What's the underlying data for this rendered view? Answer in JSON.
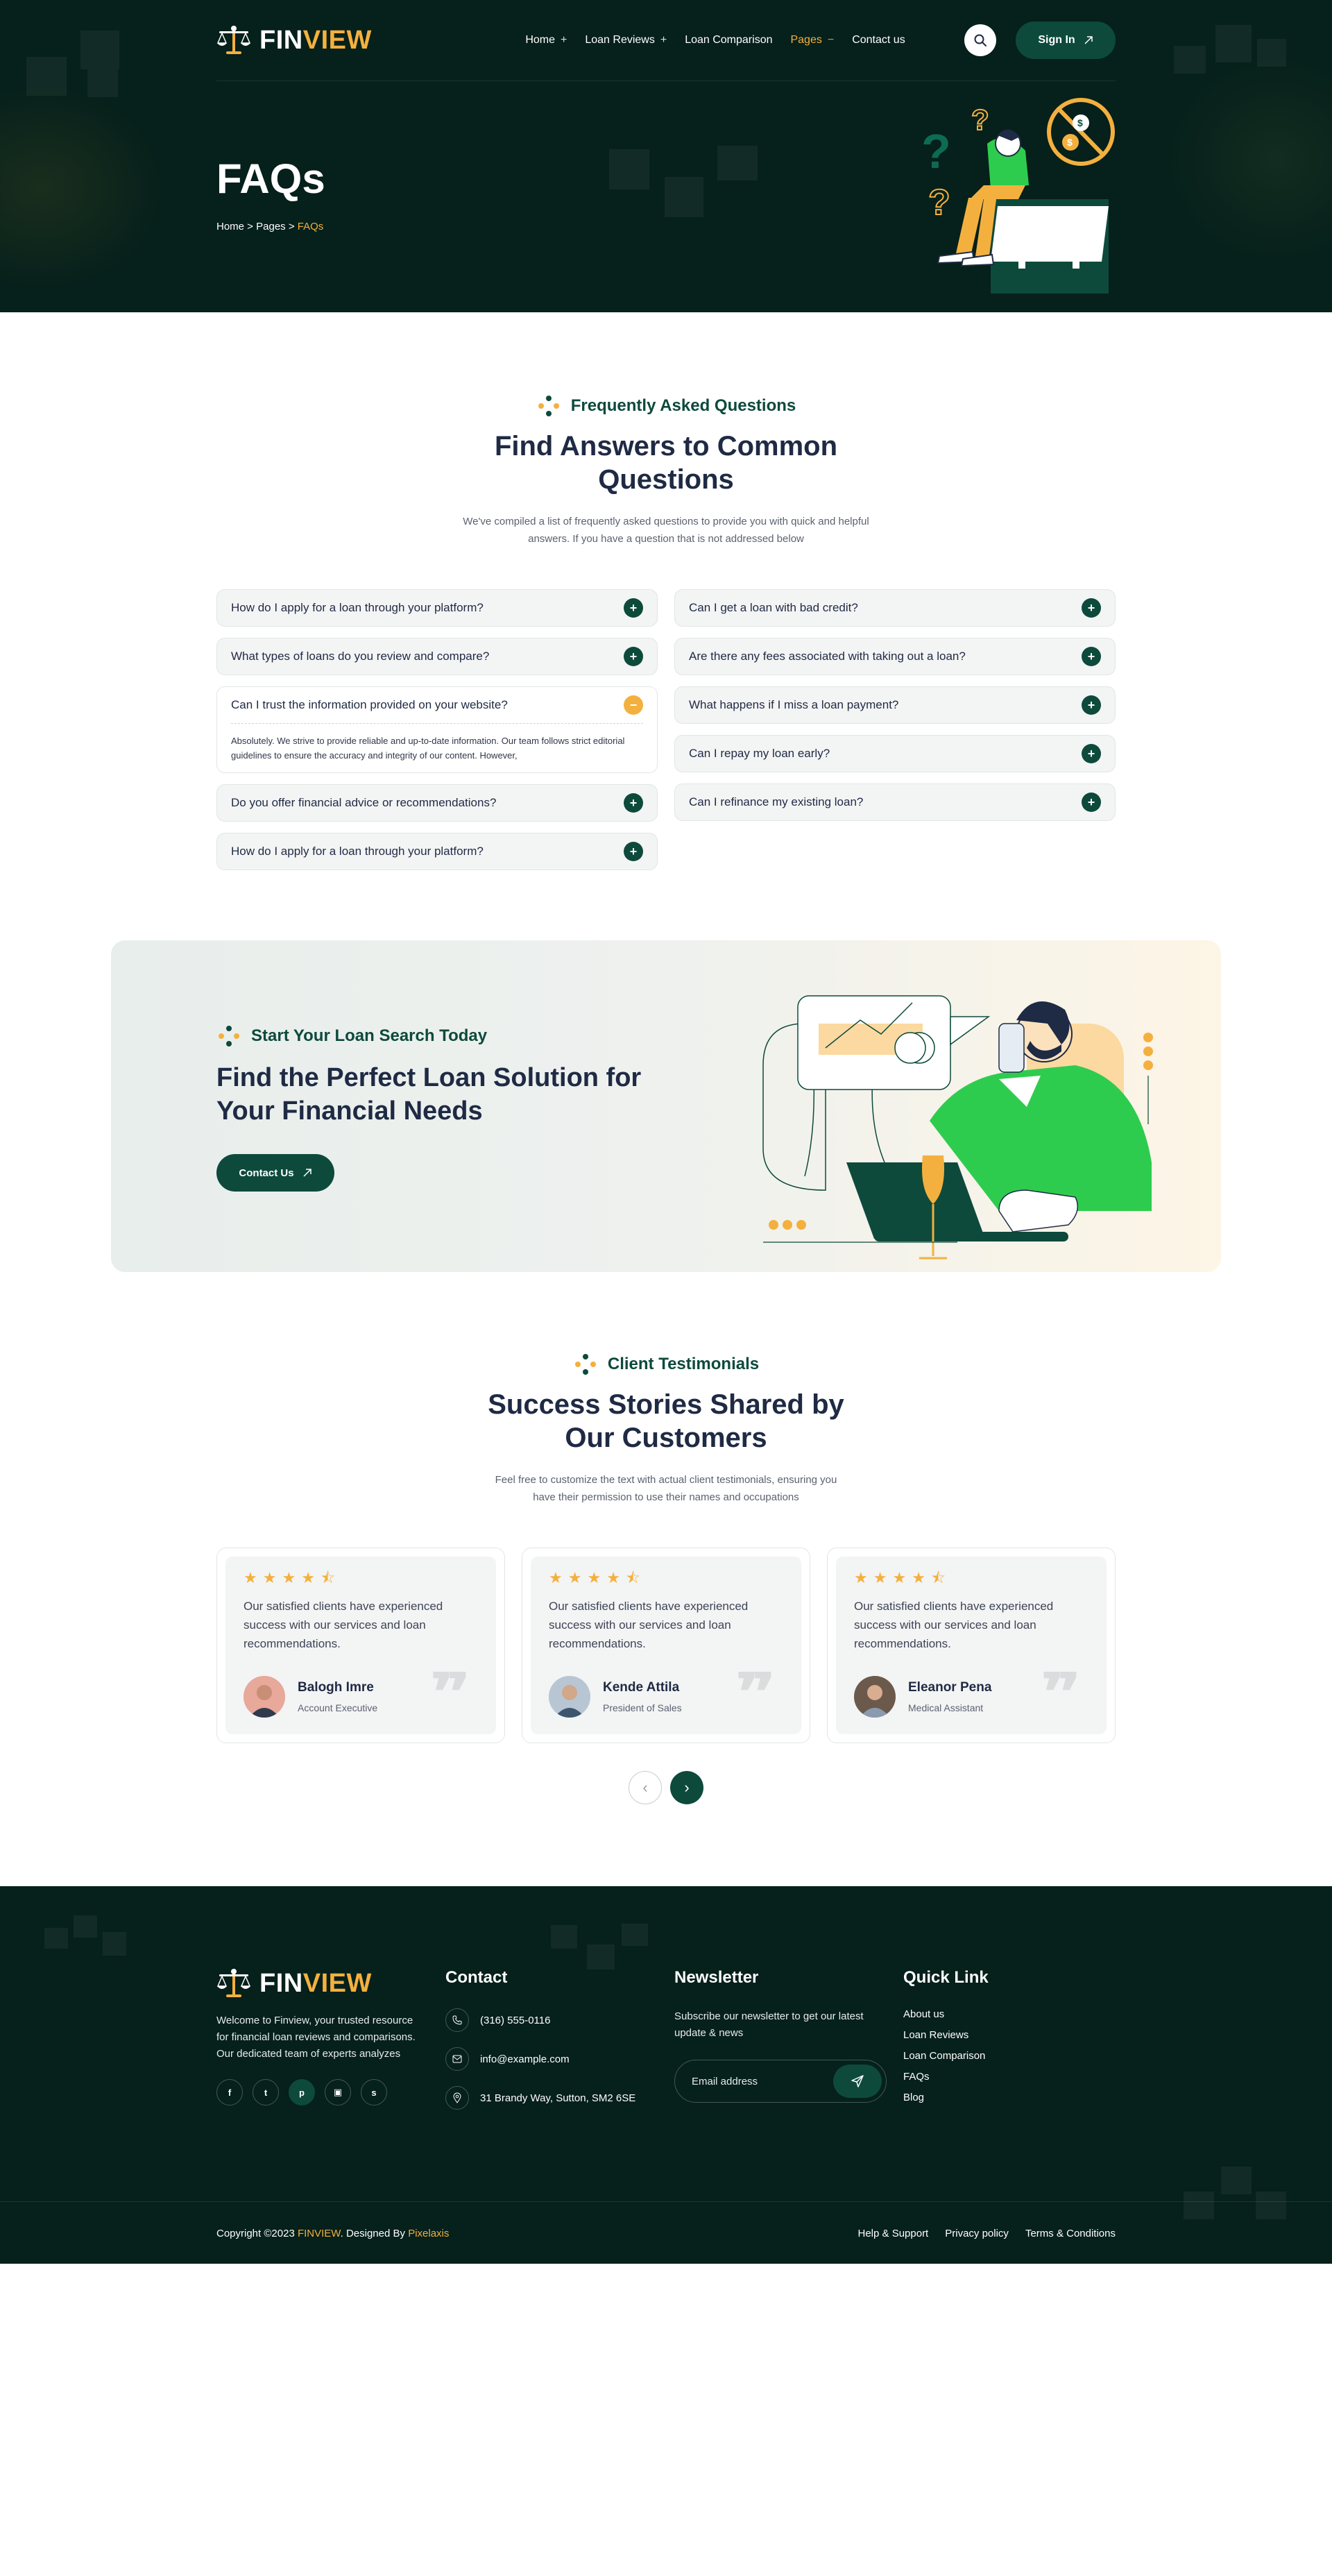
{
  "brand": {
    "part1": "FIN",
    "part2": "VIEW"
  },
  "nav": {
    "items": [
      {
        "label": "Home",
        "suffix": "+"
      },
      {
        "label": "Loan Reviews",
        "suffix": "+"
      },
      {
        "label": "Loan Comparison",
        "suffix": ""
      },
      {
        "label": "Pages",
        "suffix": "−"
      },
      {
        "label": "Contact us",
        "suffix": ""
      }
    ],
    "signin": "Sign In"
  },
  "hero": {
    "title": "FAQs",
    "crumbs": {
      "home": "Home",
      "sep1": " > ",
      "pages": "Pages",
      "sep2": " > ",
      "current": "FAQs"
    }
  },
  "faq": {
    "tag": "Frequently Asked Questions",
    "title_line1": "Find Answers to Common",
    "title_line2": "Questions",
    "desc_line1": "We've compiled a list of frequently asked questions to provide you with quick and helpful",
    "desc_line2": "answers. If you have a question that is not addressed below",
    "left": [
      {
        "q": "How do I apply for a loan through your platform?"
      },
      {
        "q": "What types of loans do you review and compare?"
      },
      {
        "q": "Can I trust the information provided on your website?",
        "a": "Absolutely. We strive to provide reliable and up-to-date information. Our team follows strict editorial guidelines to ensure the accuracy and integrity of our content. However,"
      },
      {
        "q": "Do you offer financial advice or recommendations?"
      },
      {
        "q": "How do I apply for a loan through your platform?"
      }
    ],
    "right": [
      {
        "q": "Can I get a loan with bad credit?"
      },
      {
        "q": "Are there any fees associated with taking out a loan?"
      },
      {
        "q": "What happens if I miss a loan payment?"
      },
      {
        "q": "Can I repay my loan early?"
      },
      {
        "q": "Can I refinance my existing loan?"
      }
    ],
    "icon_plus": "+",
    "icon_minus": "−"
  },
  "cta": {
    "tag": "Start Your Loan Search Today",
    "title": "Find the Perfect Loan Solution for Your Financial Needs",
    "button": "Contact Us"
  },
  "testimonials": {
    "tag": "Client Testimonials",
    "title_line1": "Success Stories Shared by",
    "title_line2": "Our Customers",
    "desc_line1": "Feel free to customize the text with actual client testimonials, ensuring you",
    "desc_line2": "have their permission to use their names and occupations",
    "rating": 4.5,
    "items": [
      {
        "text": "Our satisfied clients have experienced success with our services and loan recommendations.",
        "name": "Balogh Imre",
        "role": "Account Executive"
      },
      {
        "text": "Our satisfied clients have experienced success with our services and loan recommendations.",
        "name": "Kende Attila",
        "role": "President of Sales"
      },
      {
        "text": "Our satisfied clients have experienced success with our services and loan recommendations.",
        "name": "Eleanor Pena",
        "role": "Medical Assistant"
      }
    ]
  },
  "footer": {
    "about": "Welcome to Finview, your trusted resource for financial loan reviews and comparisons. Our dedicated team of experts analyzes",
    "socials": [
      "facebook-icon",
      "twitter-icon",
      "pinterest-icon",
      "twitch-icon",
      "skype-icon"
    ],
    "contact": {
      "title": "Contact",
      "phone": "(316) 555-0116",
      "email": "info@example.com",
      "address": "31 Brandy Way, Sutton, SM2 6SE"
    },
    "newsletter": {
      "title": "Newsletter",
      "text": "Subscribe our newsletter to get our latest update & news",
      "placeholder": "Email address"
    },
    "quick": {
      "title": "Quick Link",
      "links": [
        "About us",
        "Loan Reviews",
        "Loan Comparison",
        "FAQs",
        "Blog"
      ]
    },
    "copyright": {
      "pre": "Copyright ©2023 ",
      "brand": "FINVIEW",
      "mid": ". Designed By ",
      "designer": "Pixelaxis"
    },
    "legal": [
      "Help & Support",
      "Privacy policy",
      "Terms & Conditions"
    ]
  },
  "colors": {
    "dark": "#06201b",
    "primary": "#0d4a3c",
    "accent": "#f4b03e",
    "text": "#1f2a44"
  }
}
